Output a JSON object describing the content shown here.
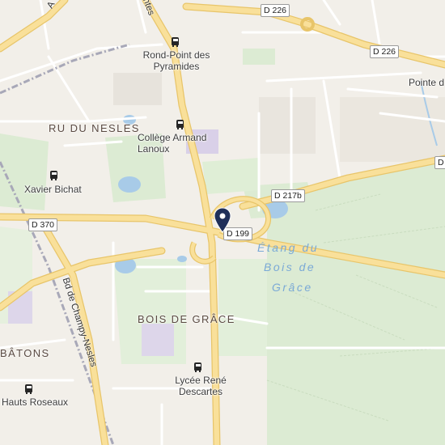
{
  "map": {
    "bus_stops": [
      {
        "name": "Rond-Point des Pyramides"
      },
      {
        "name": "Collège Armand Lanoux"
      },
      {
        "name": "Xavier Bichat"
      },
      {
        "name": "Lycée René Descartes"
      },
      {
        "name": "Hauts Roseaux"
      }
    ],
    "places": {
      "ru_du_nesles": "RU DU NESLES",
      "bois_de_grace": "BOIS DE GRÂCE",
      "batons": "BÂTONS",
      "pointe_d": "Pointe d"
    },
    "water": {
      "line1": "Étang du",
      "line2": "Bois de",
      "line3": "Grâce"
    },
    "roads": {
      "d226_top": "D 226",
      "d226_right": "D 226",
      "d217b": "D 217b",
      "d370": "D 370",
      "d199": "D 199",
      "d_edge": "D",
      "bd_champy": "Bd de Champy-Nesles",
      "top_street_a": "A",
      "top_street_b": "ntes"
    },
    "colors": {
      "background": "#f2efe9",
      "park": "#dcebd3",
      "water": "#a8cbe8",
      "major_road": "#f9e09a",
      "major_road_casing": "#e8c56a",
      "pin": "#1f2f59"
    },
    "marker_icon": "location-pin-icon"
  }
}
